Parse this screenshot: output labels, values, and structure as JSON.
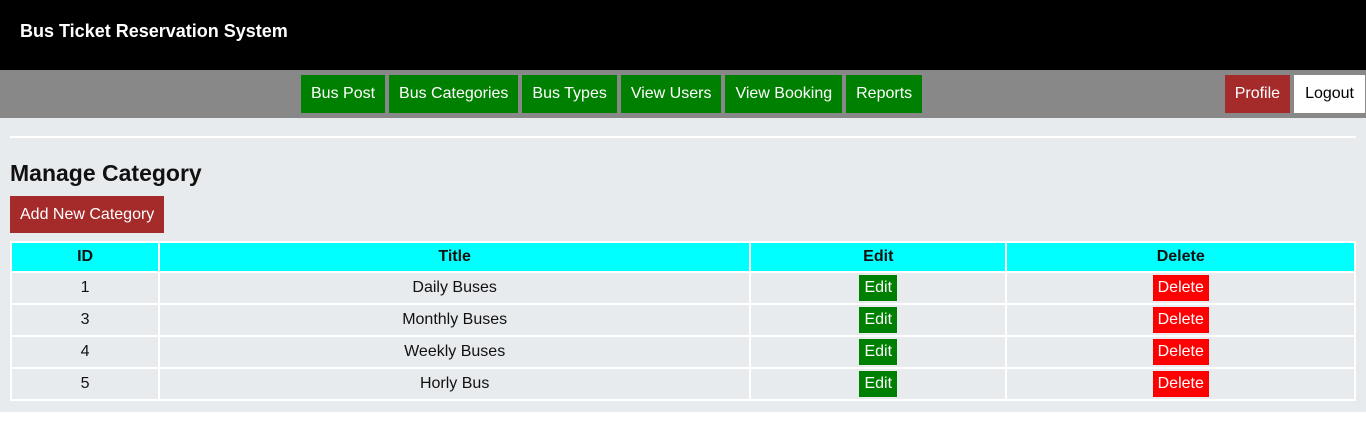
{
  "header": {
    "title": "Bus Ticket Reservation System"
  },
  "nav": {
    "items": [
      {
        "label": "Bus Post"
      },
      {
        "label": "Bus Categories"
      },
      {
        "label": "Bus Types"
      },
      {
        "label": "View Users"
      },
      {
        "label": "View Booking"
      },
      {
        "label": "Reports"
      }
    ],
    "profile_label": "Profile",
    "logout_label": "Logout"
  },
  "main": {
    "title": "Manage Category",
    "add_button_label": "Add New Category"
  },
  "table": {
    "columns": [
      "ID",
      "Title",
      "Edit",
      "Delete"
    ],
    "edit_label": "Edit",
    "delete_label": "Delete",
    "rows": [
      {
        "id": "1",
        "title": "Daily Buses"
      },
      {
        "id": "3",
        "title": "Monthly Buses"
      },
      {
        "id": "4",
        "title": "Weekly Buses"
      },
      {
        "id": "5",
        "title": "Horly Bus"
      }
    ]
  },
  "colors": {
    "header_bg": "#000000",
    "nav_bg": "#888888",
    "nav_button": "#008000",
    "profile_button": "#a52a2a",
    "table_header": "#00ffff",
    "delete_button": "#ff0000"
  }
}
